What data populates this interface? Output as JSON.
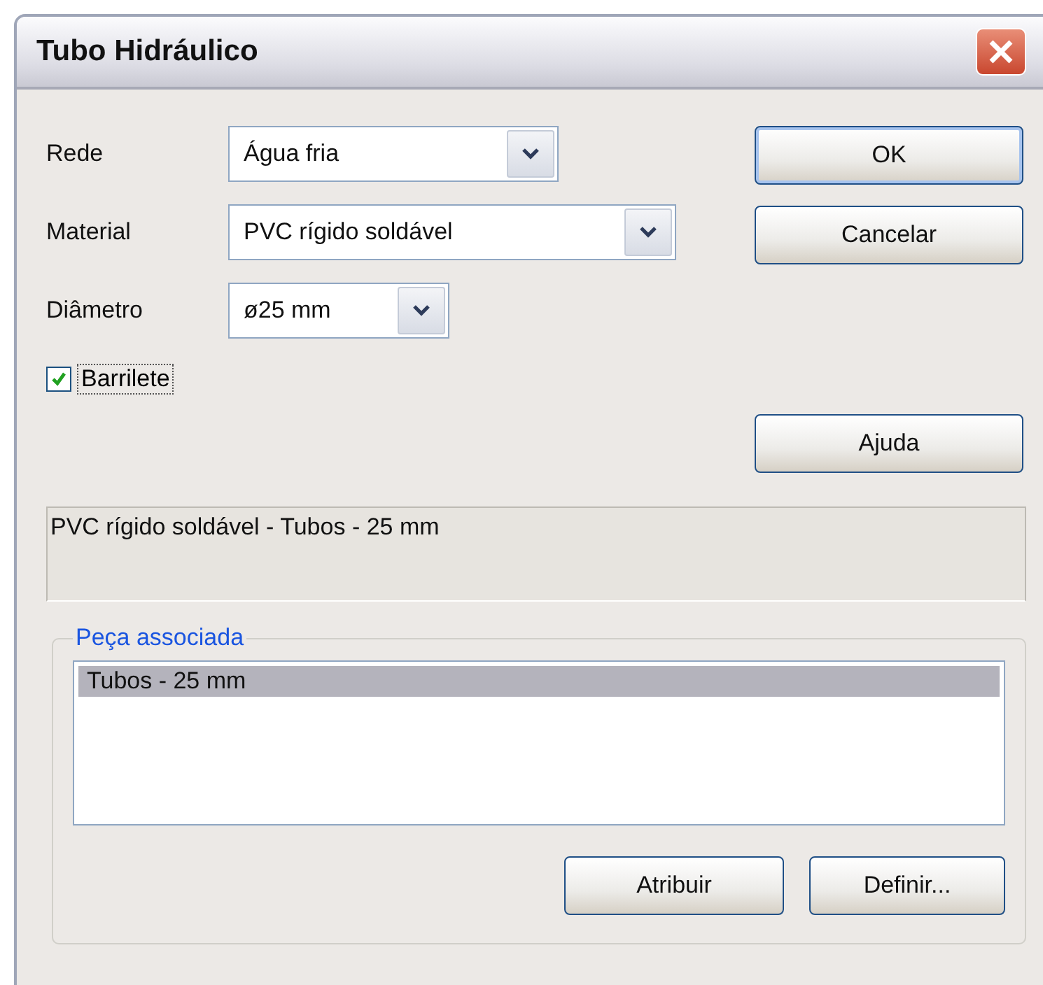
{
  "window": {
    "title": "Tubo Hidráulico"
  },
  "fields": [
    {
      "label": "Rede",
      "value": "Água fria"
    },
    {
      "label": "Material",
      "value": "PVC rígido soldável"
    },
    {
      "label": "Diâmetro",
      "value": "ø25 mm"
    }
  ],
  "checkbox": {
    "label": "Barrilete",
    "checked": true
  },
  "buttons": [
    "OK",
    "Cancelar"
  ],
  "help_button": "Ajuda",
  "description": "PVC rígido soldável - Tubos - 25 mm",
  "group": {
    "title": "Peça associada",
    "items": [
      {
        "label": "Tubos - 25 mm",
        "selected": true
      }
    ],
    "buttons": [
      "Atribuir",
      "Definir..."
    ]
  }
}
